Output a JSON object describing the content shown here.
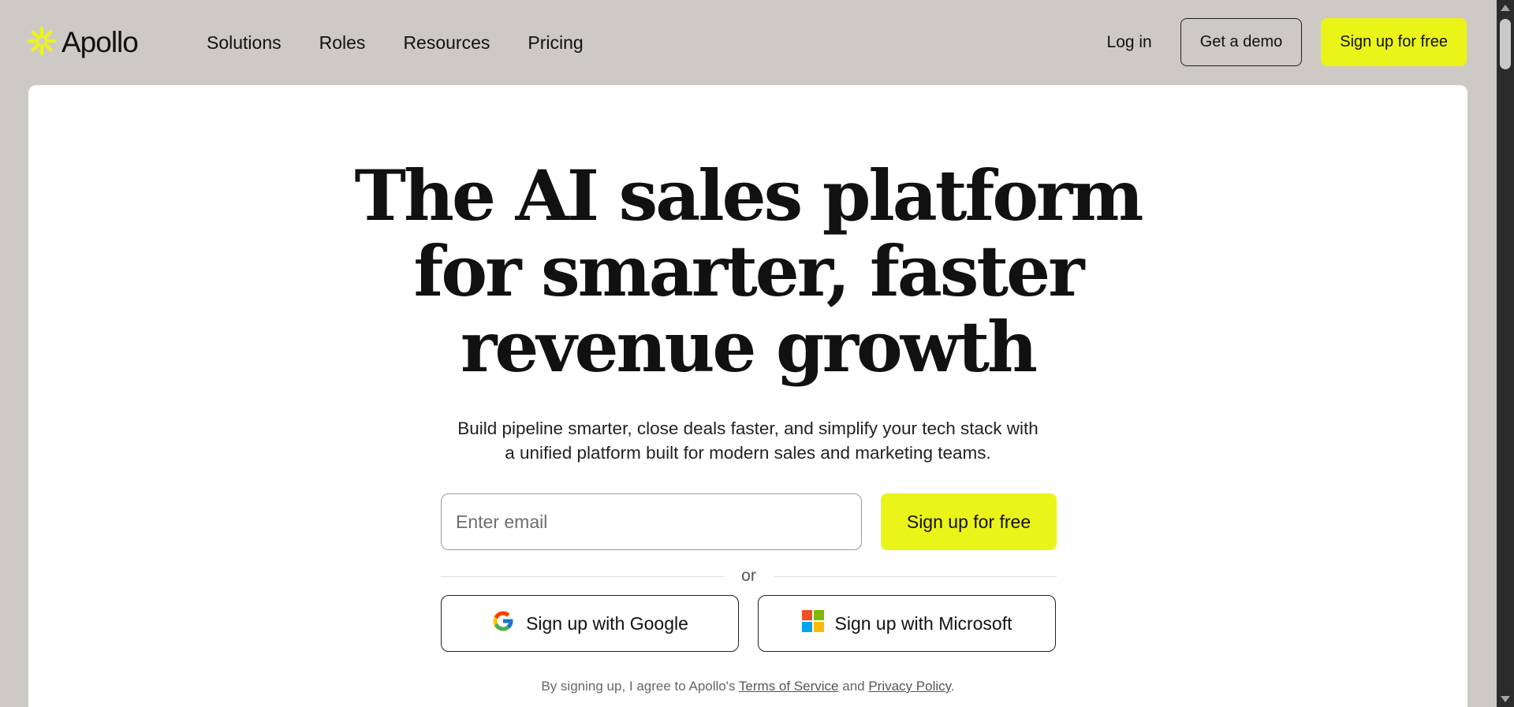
{
  "brand": {
    "name": "Apollo",
    "logo_icon": "asterisk-sun-icon",
    "accent": "#ebf419"
  },
  "nav": {
    "links": [
      "Solutions",
      "Roles",
      "Resources",
      "Pricing"
    ],
    "login": "Log in",
    "demo": "Get a demo",
    "signup": "Sign up for free"
  },
  "hero": {
    "headline": [
      "The AI sales platform",
      "for smarter, faster",
      "revenue growth"
    ],
    "subtitle": [
      "Build pipeline smarter, close deals faster, and simplify your tech stack with",
      "a unified platform built for modern sales and marketing teams."
    ],
    "email_placeholder": "Enter email",
    "signup": "Sign up for free",
    "or": "or",
    "google": "Sign up with Google",
    "microsoft": "Sign up with Microsoft",
    "legal": {
      "prefix": "By signing up, I agree to Apollo's ",
      "terms": "Terms of Service",
      "and": " and ",
      "privacy": "Privacy Policy",
      "suffix": "."
    }
  }
}
